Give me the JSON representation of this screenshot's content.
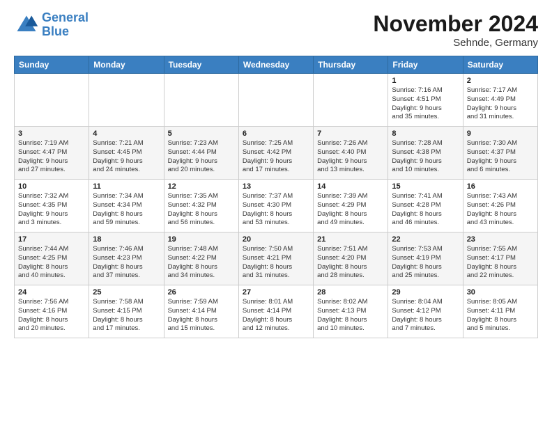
{
  "header": {
    "logo_line1": "General",
    "logo_line2": "Blue",
    "month_title": "November 2024",
    "location": "Sehnde, Germany"
  },
  "weekdays": [
    "Sunday",
    "Monday",
    "Tuesday",
    "Wednesday",
    "Thursday",
    "Friday",
    "Saturday"
  ],
  "weeks": [
    [
      {
        "day": "",
        "info": ""
      },
      {
        "day": "",
        "info": ""
      },
      {
        "day": "",
        "info": ""
      },
      {
        "day": "",
        "info": ""
      },
      {
        "day": "",
        "info": ""
      },
      {
        "day": "1",
        "info": "Sunrise: 7:16 AM\nSunset: 4:51 PM\nDaylight: 9 hours\nand 35 minutes."
      },
      {
        "day": "2",
        "info": "Sunrise: 7:17 AM\nSunset: 4:49 PM\nDaylight: 9 hours\nand 31 minutes."
      }
    ],
    [
      {
        "day": "3",
        "info": "Sunrise: 7:19 AM\nSunset: 4:47 PM\nDaylight: 9 hours\nand 27 minutes."
      },
      {
        "day": "4",
        "info": "Sunrise: 7:21 AM\nSunset: 4:45 PM\nDaylight: 9 hours\nand 24 minutes."
      },
      {
        "day": "5",
        "info": "Sunrise: 7:23 AM\nSunset: 4:44 PM\nDaylight: 9 hours\nand 20 minutes."
      },
      {
        "day": "6",
        "info": "Sunrise: 7:25 AM\nSunset: 4:42 PM\nDaylight: 9 hours\nand 17 minutes."
      },
      {
        "day": "7",
        "info": "Sunrise: 7:26 AM\nSunset: 4:40 PM\nDaylight: 9 hours\nand 13 minutes."
      },
      {
        "day": "8",
        "info": "Sunrise: 7:28 AM\nSunset: 4:38 PM\nDaylight: 9 hours\nand 10 minutes."
      },
      {
        "day": "9",
        "info": "Sunrise: 7:30 AM\nSunset: 4:37 PM\nDaylight: 9 hours\nand 6 minutes."
      }
    ],
    [
      {
        "day": "10",
        "info": "Sunrise: 7:32 AM\nSunset: 4:35 PM\nDaylight: 9 hours\nand 3 minutes."
      },
      {
        "day": "11",
        "info": "Sunrise: 7:34 AM\nSunset: 4:34 PM\nDaylight: 8 hours\nand 59 minutes."
      },
      {
        "day": "12",
        "info": "Sunrise: 7:35 AM\nSunset: 4:32 PM\nDaylight: 8 hours\nand 56 minutes."
      },
      {
        "day": "13",
        "info": "Sunrise: 7:37 AM\nSunset: 4:30 PM\nDaylight: 8 hours\nand 53 minutes."
      },
      {
        "day": "14",
        "info": "Sunrise: 7:39 AM\nSunset: 4:29 PM\nDaylight: 8 hours\nand 49 minutes."
      },
      {
        "day": "15",
        "info": "Sunrise: 7:41 AM\nSunset: 4:28 PM\nDaylight: 8 hours\nand 46 minutes."
      },
      {
        "day": "16",
        "info": "Sunrise: 7:43 AM\nSunset: 4:26 PM\nDaylight: 8 hours\nand 43 minutes."
      }
    ],
    [
      {
        "day": "17",
        "info": "Sunrise: 7:44 AM\nSunset: 4:25 PM\nDaylight: 8 hours\nand 40 minutes."
      },
      {
        "day": "18",
        "info": "Sunrise: 7:46 AM\nSunset: 4:23 PM\nDaylight: 8 hours\nand 37 minutes."
      },
      {
        "day": "19",
        "info": "Sunrise: 7:48 AM\nSunset: 4:22 PM\nDaylight: 8 hours\nand 34 minutes."
      },
      {
        "day": "20",
        "info": "Sunrise: 7:50 AM\nSunset: 4:21 PM\nDaylight: 8 hours\nand 31 minutes."
      },
      {
        "day": "21",
        "info": "Sunrise: 7:51 AM\nSunset: 4:20 PM\nDaylight: 8 hours\nand 28 minutes."
      },
      {
        "day": "22",
        "info": "Sunrise: 7:53 AM\nSunset: 4:19 PM\nDaylight: 8 hours\nand 25 minutes."
      },
      {
        "day": "23",
        "info": "Sunrise: 7:55 AM\nSunset: 4:17 PM\nDaylight: 8 hours\nand 22 minutes."
      }
    ],
    [
      {
        "day": "24",
        "info": "Sunrise: 7:56 AM\nSunset: 4:16 PM\nDaylight: 8 hours\nand 20 minutes."
      },
      {
        "day": "25",
        "info": "Sunrise: 7:58 AM\nSunset: 4:15 PM\nDaylight: 8 hours\nand 17 minutes."
      },
      {
        "day": "26",
        "info": "Sunrise: 7:59 AM\nSunset: 4:14 PM\nDaylight: 8 hours\nand 15 minutes."
      },
      {
        "day": "27",
        "info": "Sunrise: 8:01 AM\nSunset: 4:14 PM\nDaylight: 8 hours\nand 12 minutes."
      },
      {
        "day": "28",
        "info": "Sunrise: 8:02 AM\nSunset: 4:13 PM\nDaylight: 8 hours\nand 10 minutes."
      },
      {
        "day": "29",
        "info": "Sunrise: 8:04 AM\nSunset: 4:12 PM\nDaylight: 8 hours\nand 7 minutes."
      },
      {
        "day": "30",
        "info": "Sunrise: 8:05 AM\nSunset: 4:11 PM\nDaylight: 8 hours\nand 5 minutes."
      }
    ]
  ]
}
